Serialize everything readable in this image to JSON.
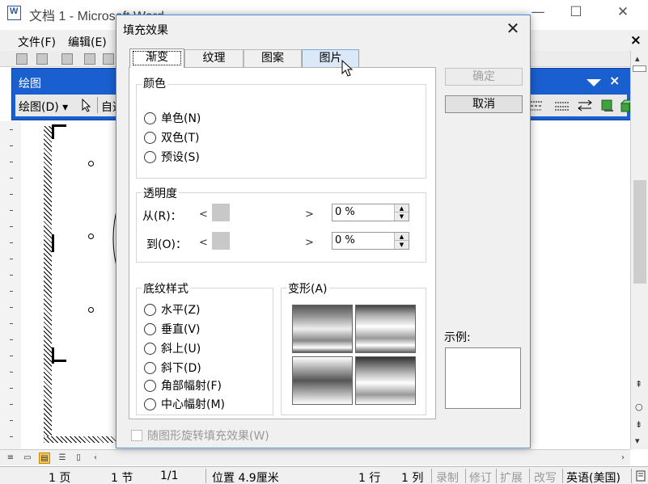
{
  "word": {
    "title": "文档 1 - Microsoft Word",
    "menu": [
      "文件(F)",
      "编辑(E)"
    ],
    "menu_close": "×",
    "window_controls": [
      "—",
      "☐",
      "✕"
    ]
  },
  "draw_toolbar": {
    "title": "绘图",
    "draw_menu": "绘图(D) ▾",
    "autoshapes": "自选",
    "close": "×"
  },
  "statusbar": {
    "page": "1 页",
    "section": "1 节",
    "pages": "1/1",
    "position": "位置 4.9厘米",
    "line": "1 行",
    "col": "1 列",
    "rec": "录制",
    "trk": "修订",
    "ext": "扩展",
    "ovr": "改写",
    "lang": "英语(美国)"
  },
  "dialog": {
    "title": "填充效果",
    "close": "✕",
    "tabs": [
      {
        "label": "渐变",
        "active": true
      },
      {
        "label": "纹理",
        "active": false
      },
      {
        "label": "图案",
        "active": false
      },
      {
        "label": "图片",
        "active": false
      }
    ],
    "colors": {
      "label": "颜色",
      "options": [
        "单色(N)",
        "双色(T)",
        "预设(S)"
      ]
    },
    "transparency": {
      "label": "透明度",
      "from_label": "从(R)：",
      "to_label": "到(O)：",
      "from_value": "0 %",
      "to_value": "0 %",
      "left_arrow": "<",
      "right_arrow": ">"
    },
    "shading": {
      "label": "底纹样式",
      "options": [
        "水平(Z)",
        "垂直(V)",
        "斜上(U)",
        "斜下(D)",
        "角部幅射(F)",
        "中心幅射(M)"
      ]
    },
    "variants": {
      "label": "变形(A)"
    },
    "rotate_checkbox": "随图形旋转填充效果(W)",
    "ok_button": "确定",
    "cancel_button": "取消",
    "preview_label": "示例:"
  }
}
